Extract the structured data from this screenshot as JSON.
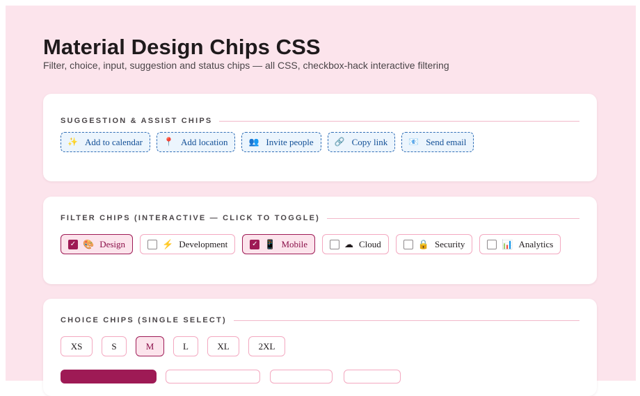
{
  "header": {
    "title": "Material Design Chips CSS",
    "subtitle": "Filter, choice, input, suggestion and status chips — all CSS, checkbox-hack interactive filtering"
  },
  "suggestion": {
    "heading": "SUGGESTION & ASSIST CHIPS",
    "chips": [
      {
        "icon": "✨",
        "icon_name": "sparkles-icon",
        "label": "Add to calendar"
      },
      {
        "icon": "📍",
        "icon_name": "pin-icon",
        "label": "Add location"
      },
      {
        "icon": "👥",
        "icon_name": "people-icon",
        "label": "Invite people"
      },
      {
        "icon": "🔗",
        "icon_name": "link-icon",
        "label": "Copy link"
      },
      {
        "icon": "📧",
        "icon_name": "email-icon",
        "label": "Send email"
      }
    ]
  },
  "filter": {
    "heading": "FILTER CHIPS (INTERACTIVE — CLICK TO TOGGLE)",
    "check_mark": "✓",
    "chips": [
      {
        "icon": "🎨",
        "icon_name": "palette-icon",
        "label": "Design",
        "checked": true
      },
      {
        "icon": "⚡",
        "icon_name": "lightning-icon",
        "label": "Development",
        "checked": false
      },
      {
        "icon": "📱",
        "icon_name": "mobile-phone-icon",
        "label": "Mobile",
        "checked": true
      },
      {
        "icon": "☁",
        "icon_name": "cloud-icon",
        "label": "Cloud",
        "checked": false
      },
      {
        "icon": "🔒",
        "icon_name": "lock-icon",
        "label": "Security",
        "checked": false
      },
      {
        "icon": "📊",
        "icon_name": "bar-chart-icon",
        "label": "Analytics",
        "checked": false
      }
    ]
  },
  "choice": {
    "heading": "CHOICE CHIPS (SINGLE SELECT)",
    "chips": [
      {
        "label": "XS",
        "selected": false
      },
      {
        "label": "S",
        "selected": false
      },
      {
        "label": "M",
        "selected": true
      },
      {
        "label": "L",
        "selected": false
      },
      {
        "label": "XL",
        "selected": false
      },
      {
        "label": "2XL",
        "selected": false
      }
    ]
  },
  "colors": {
    "page_bg": "#fce4ec",
    "accent": "#9e1a55",
    "assist_border": "#2f6db5",
    "assist_text": "#124f96"
  }
}
